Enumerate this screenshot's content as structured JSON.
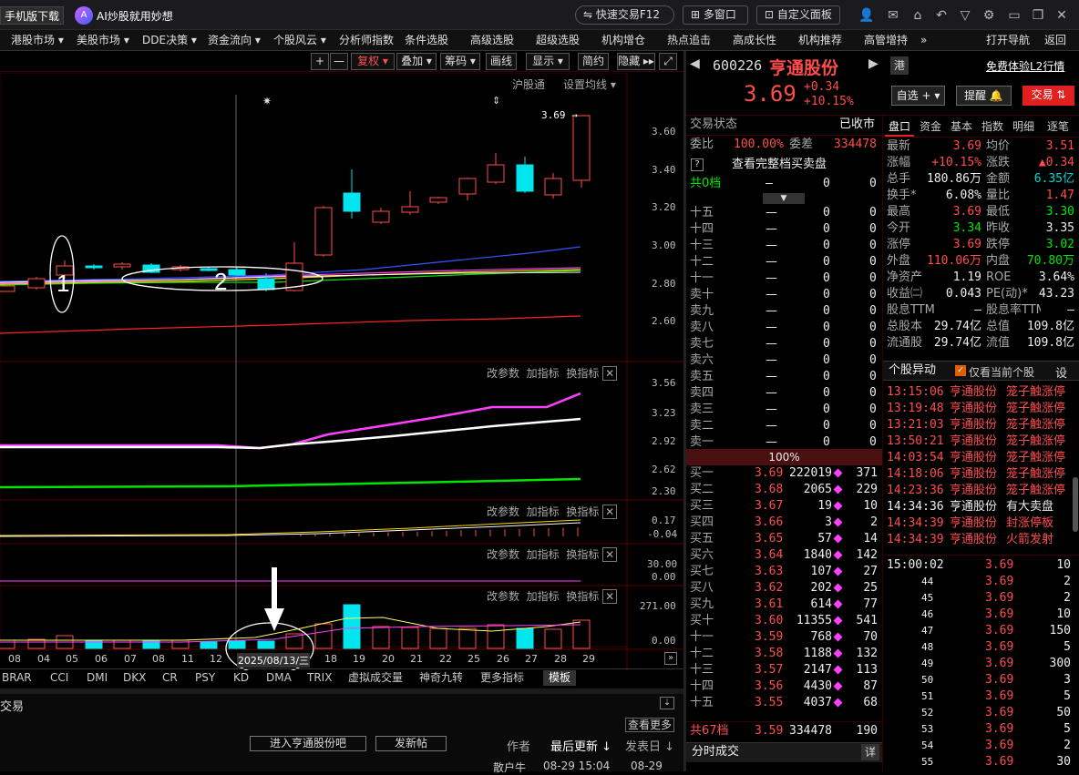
{
  "titlebar": {
    "mobile_download": "手机版下载",
    "ai_slogan": "AI炒股就用妙想",
    "quick_trade": "快速交易F12",
    "multi_window": "多窗口",
    "custom_panel": "自定义面板"
  },
  "menubar": {
    "items": [
      "港股市场 ▾",
      "美股市场 ▾",
      "DDE决策 ▾",
      "资金流向 ▾",
      "个股风云 ▾",
      "分析师指数",
      "条件选股",
      "高级选股",
      "超级选股",
      "机构增仓",
      "热点追击",
      "高成长性",
      "机构推荐",
      "高管增持"
    ],
    "more": "»",
    "open_nav": "打开导航",
    "back": "返回"
  },
  "chart_toolbar": {
    "plus": "+",
    "minus": "—",
    "fuquan": "复权 ▾",
    "diejia": "叠加 ▾",
    "chouma": "筹码 ▾",
    "huaxian": "画线",
    "xianshi": "显示 ▾",
    "jianyue": "简约",
    "yincang": "隐藏 ▸▸",
    "expand": "⤢"
  },
  "main_chart": {
    "hugutong": "沪股通",
    "set_ma": "设置均线 ▾",
    "price_tag": "3.69 →",
    "y_ticks": [
      "3.60",
      "3.40",
      "3.20",
      "3.00",
      "2.80",
      "2.60"
    ],
    "annotations": [
      "1",
      "2"
    ]
  },
  "indicator_links": {
    "params": "改参数",
    "add": "加指标",
    "switch": "换指标"
  },
  "ind1_ticks": [
    "3.56",
    "3.23",
    "2.92",
    "2.62",
    "2.30"
  ],
  "ind2_ticks": [
    "0.17",
    "-0.04"
  ],
  "ind3_ticks": [
    "30.00",
    "0.00"
  ],
  "ind4_ticks": [
    "271.00",
    "0.00"
  ],
  "dates": [
    "08",
    "04",
    "05",
    "06",
    "07",
    "08",
    "11",
    "12",
    "2025/08/13/三",
    "18",
    "19",
    "20",
    "21",
    "22",
    "25",
    "26",
    "27",
    "28",
    "29"
  ],
  "bottom_tabs": [
    "BRAR",
    "CCI",
    "DMI",
    "DKX",
    "CR",
    "PSY",
    "KD",
    "DMA",
    "TRIX",
    "虚拟成交量",
    "神奇九转",
    "更多指标",
    "模板"
  ],
  "bottom_panel": {
    "trade": "交易",
    "view_more": "查看更多",
    "enter_forum": "进入亨通股份吧",
    "new_post": "发新帖",
    "author": "作者",
    "last_update": "最后更新 ↓",
    "post_date": "发表日 ↓",
    "row_author": "散户牛",
    "row_update": "08-29 15:04",
    "row_post": "08-29"
  },
  "stock": {
    "code": "600226",
    "name": "亨通股份",
    "hk": "港",
    "free_l2": "免费体验L2行情",
    "price": "3.69",
    "change": "+0.34",
    "change_pct": "+10.15%",
    "add_watch": "自选 + ▾",
    "remind": "提醒 🔔",
    "trade": "交易 ⇅"
  },
  "status": {
    "label": "交易状态",
    "value": "已收市",
    "weibi_label": "委比",
    "weibi": "100.00%",
    "weicha_label": "委差",
    "weicha": "334478",
    "full_book": "查看完整档买卖盘",
    "top_label": "共0档",
    "top_vol": "0",
    "top_cnt": "0"
  },
  "sell_levels": [
    {
      "l": "十五"
    },
    {
      "l": "十四"
    },
    {
      "l": "十三"
    },
    {
      "l": "十二"
    },
    {
      "l": "十一"
    },
    {
      "l": "卖十"
    },
    {
      "l": "卖九"
    },
    {
      "l": "卖八"
    },
    {
      "l": "卖七"
    },
    {
      "l": "卖六"
    },
    {
      "l": "卖五"
    },
    {
      "l": "卖四"
    },
    {
      "l": "卖三"
    },
    {
      "l": "卖二"
    },
    {
      "l": "卖一"
    }
  ],
  "sell_dash": "—",
  "sell_zero": "0",
  "book_ratio": "100%",
  "buy_levels": [
    {
      "l": "买一",
      "p": "3.69",
      "v": "222019",
      "c": "371"
    },
    {
      "l": "买二",
      "p": "3.68",
      "v": "2065",
      "c": "229"
    },
    {
      "l": "买三",
      "p": "3.67",
      "v": "19",
      "c": "10"
    },
    {
      "l": "买四",
      "p": "3.66",
      "v": "3",
      "c": "2"
    },
    {
      "l": "买五",
      "p": "3.65",
      "v": "57",
      "c": "14"
    },
    {
      "l": "买六",
      "p": "3.64",
      "v": "1840",
      "c": "142"
    },
    {
      "l": "买七",
      "p": "3.63",
      "v": "107",
      "c": "27"
    },
    {
      "l": "买八",
      "p": "3.62",
      "v": "202",
      "c": "25"
    },
    {
      "l": "买九",
      "p": "3.61",
      "v": "614",
      "c": "77"
    },
    {
      "l": "买十",
      "p": "3.60",
      "v": "11355",
      "c": "541"
    },
    {
      "l": "十一",
      "p": "3.59",
      "v": "768",
      "c": "70"
    },
    {
      "l": "十二",
      "p": "3.58",
      "v": "1188",
      "c": "132"
    },
    {
      "l": "十三",
      "p": "3.57",
      "v": "2147",
      "c": "113"
    },
    {
      "l": "十四",
      "p": "3.56",
      "v": "4430",
      "c": "87"
    },
    {
      "l": "十五",
      "p": "3.55",
      "v": "4037",
      "c": "68"
    }
  ],
  "buy_total": {
    "l": "共67档",
    "p": "3.59",
    "v": "334478",
    "c": "190"
  },
  "tick_trades_label": "分时成交",
  "tick_detail": "详",
  "tabs": [
    "盘口",
    "资金",
    "基本",
    "指数",
    "明细",
    "逐笔"
  ],
  "quote": [
    {
      "a": "最新",
      "av": "3.69",
      "ac": "red",
      "b": "均价",
      "bv": "3.51",
      "bc": "red"
    },
    {
      "a": "涨幅",
      "av": "+10.15%",
      "ac": "red",
      "b": "涨跌",
      "bv": "▲0.34",
      "bc": "red"
    },
    {
      "a": "总手",
      "av": "180.86万",
      "ac": "white",
      "b": "金额",
      "bv": "6.35亿",
      "bc": "cyan"
    },
    {
      "a": "换手*",
      "av": "6.08%",
      "ac": "white",
      "b": "量比",
      "bv": "1.47",
      "bc": "red"
    },
    {
      "a": "最高",
      "av": "3.69",
      "ac": "red",
      "b": "最低",
      "bv": "3.30",
      "bc": "green"
    },
    {
      "a": "今开",
      "av": "3.34",
      "ac": "green",
      "b": "昨收",
      "bv": "3.35",
      "bc": "white"
    },
    {
      "a": "涨停",
      "av": "3.69",
      "ac": "red",
      "b": "跌停",
      "bv": "3.02",
      "bc": "green"
    },
    {
      "a": "外盘",
      "av": "110.06万",
      "ac": "red",
      "b": "内盘",
      "bv": "70.80万",
      "bc": "green"
    },
    {
      "a": "净资产",
      "av": "1.19",
      "ac": "white",
      "b": "ROE",
      "bv": "3.64%",
      "bc": "white"
    },
    {
      "a": "收益㈡",
      "av": "0.043",
      "ac": "white",
      "b": "PE(动)*",
      "bv": "43.23",
      "bc": "white"
    },
    {
      "a": "股息TTM",
      "av": "—",
      "ac": "white",
      "b": "股息率TTM",
      "bv": "—",
      "bc": "white"
    },
    {
      "a": "总股本",
      "av": "29.74亿",
      "ac": "white",
      "b": "总值",
      "bv": "109.8亿",
      "bc": "white"
    },
    {
      "a": "流通股",
      "av": "29.74亿",
      "ac": "white",
      "b": "流值",
      "bv": "109.8亿",
      "bc": "white"
    }
  ],
  "movement": {
    "title": "个股异动",
    "only_current": "仅看当前个股",
    "settings": "设",
    "rows": [
      {
        "t": "13:15:06",
        "n": "亨通股份",
        "e": "笼子触涨停",
        "c": "red"
      },
      {
        "t": "13:19:48",
        "n": "亨通股份",
        "e": "笼子触涨停",
        "c": "red"
      },
      {
        "t": "13:21:03",
        "n": "亨通股份",
        "e": "笼子触涨停",
        "c": "red"
      },
      {
        "t": "13:50:21",
        "n": "亨通股份",
        "e": "笼子触涨停",
        "c": "red"
      },
      {
        "t": "14:03:54",
        "n": "亨通股份",
        "e": "笼子触涨停",
        "c": "red"
      },
      {
        "t": "14:18:06",
        "n": "亨通股份",
        "e": "笼子触涨停",
        "c": "red"
      },
      {
        "t": "14:23:36",
        "n": "亨通股份",
        "e": "笼子触涨停",
        "c": "red"
      },
      {
        "t": "14:34:36",
        "n": "亨通股份",
        "e": "有大卖盘",
        "c": "white"
      },
      {
        "t": "14:34:39",
        "n": "亨通股份",
        "e": "封涨停板",
        "c": "red"
      },
      {
        "t": "14:34:39",
        "n": "亨通股份",
        "e": "火箭发射",
        "c": "red"
      }
    ]
  },
  "ticks": [
    {
      "t": "15:00:02",
      "p": "3.69",
      "v": "10"
    },
    {
      "t": "44",
      "p": "3.69",
      "v": "2"
    },
    {
      "t": "45",
      "p": "3.69",
      "v": "2"
    },
    {
      "t": "46",
      "p": "3.69",
      "v": "10"
    },
    {
      "t": "47",
      "p": "3.69",
      "v": "150"
    },
    {
      "t": "48",
      "p": "3.69",
      "v": "5"
    },
    {
      "t": "49",
      "p": "3.69",
      "v": "300"
    },
    {
      "t": "50",
      "p": "3.69",
      "v": "3"
    },
    {
      "t": "51",
      "p": "3.69",
      "v": "5"
    },
    {
      "t": "52",
      "p": "3.69",
      "v": "50"
    },
    {
      "t": "53",
      "p": "3.69",
      "v": "5"
    },
    {
      "t": "54",
      "p": "3.69",
      "v": "2"
    },
    {
      "t": "55",
      "p": "3.69",
      "v": "30"
    }
  ],
  "colors": {
    "up": "#ff4d4d",
    "down": "#00e5ee",
    "ma5": "#ffffff",
    "ma10": "#ffd800",
    "ma20": "#ff40ff",
    "ma60": "#00e600",
    "ma120": "#3355ff",
    "ma250": "#ff2222"
  }
}
